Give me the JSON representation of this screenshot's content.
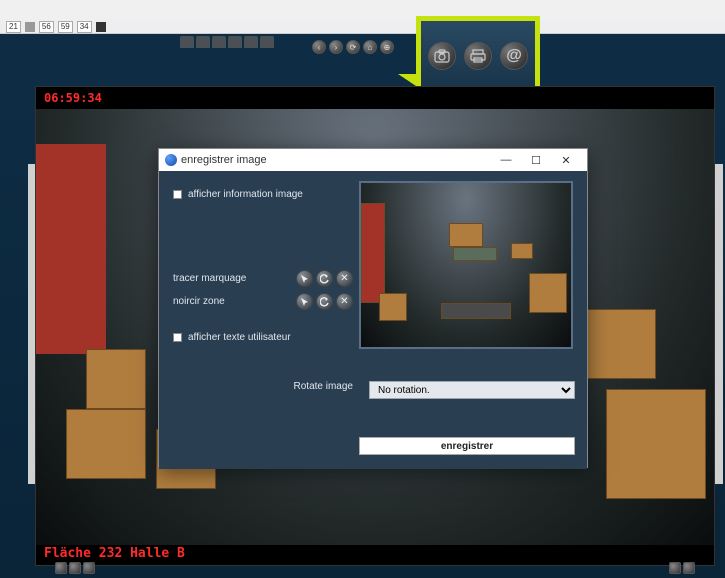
{
  "status_strip": {
    "chips": [
      "21",
      "56",
      "59",
      "34"
    ]
  },
  "callout": {
    "icons": [
      "camera-icon",
      "print-icon",
      "at-icon"
    ]
  },
  "video": {
    "timestamp": "06:59:34",
    "location": "Fläche 232 Halle B"
  },
  "dialog": {
    "title": "enregistrer image",
    "show_image_info_label": "afficher information image",
    "trace_marking_label": "tracer marquage",
    "blackout_zone_label": "noircir zone",
    "show_user_text_label": "afficher texte utilisateur",
    "rotate_label": "Rotate image",
    "rotate_options": [
      "No rotation."
    ],
    "rotate_selected": "No rotation.",
    "save_button": "enregistrer"
  }
}
